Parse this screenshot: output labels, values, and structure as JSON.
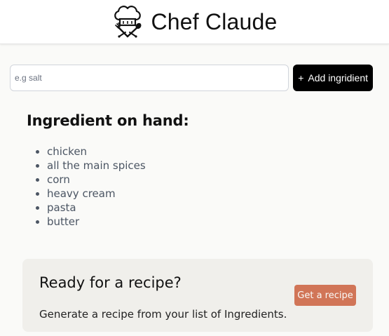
{
  "header": {
    "title": "Chef Claude",
    "logo_icon": "chef-hat-icon"
  },
  "form": {
    "input_placeholder": "e.g salt",
    "input_value": "",
    "add_button_icon": "+",
    "add_button_label": "Add ingridient"
  },
  "ingredients": {
    "heading": "Ingredient on hand:",
    "items": [
      "chicken",
      "all the main spices",
      "corn",
      "heavy cream",
      "pasta",
      "butter"
    ]
  },
  "recipe_card": {
    "heading": "Ready for a recipe?",
    "description": "Generate a recipe from your list of Ingredients.",
    "button_label": "Get a recipe"
  },
  "colors": {
    "page_background": "#fafaf8",
    "header_background": "#ffffff",
    "add_button_background": "#000000",
    "card_background": "#f0efeb",
    "recipe_button_background": "#d17557"
  }
}
